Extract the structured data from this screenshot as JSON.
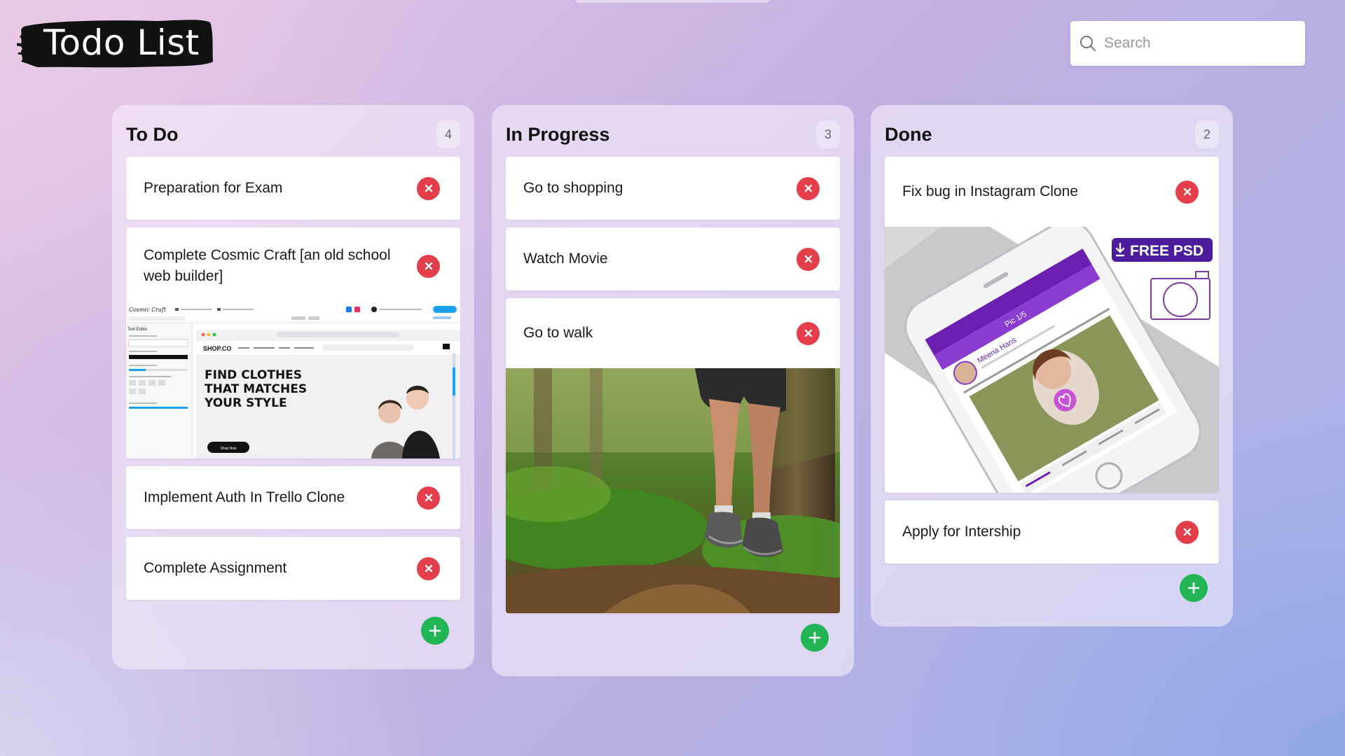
{
  "app": {
    "title": "Todo List"
  },
  "search": {
    "placeholder": "Search",
    "value": ""
  },
  "colors": {
    "delete": "#e53e4b",
    "add": "#22b556"
  },
  "columns": [
    {
      "title": "To Do",
      "count": "4",
      "cards": [
        {
          "text": "Preparation for Exam"
        },
        {
          "text": "Complete Cosmic Craft [an old school web builder]",
          "image": {
            "kind": "website-builder-screenshot",
            "brand": "Cosmic Craft",
            "panel_title": "Text Editor",
            "site_logo": "SHOP.CO",
            "hero_text": [
              "FIND CLOTHES",
              "THAT MATCHES",
              "YOUR STYLE"
            ],
            "cta": "Shop Now"
          }
        },
        {
          "text": "Implement Auth In Trello Clone"
        },
        {
          "text": "Complete Assignment"
        }
      ]
    },
    {
      "title": "In Progress",
      "count": "3",
      "cards": [
        {
          "text": "Go to shopping"
        },
        {
          "text": "Watch Movie"
        },
        {
          "text": "Go to walk",
          "image": {
            "kind": "forest-trail-hiker-photo"
          }
        }
      ]
    },
    {
      "title": "Done",
      "count": "2",
      "cards": [
        {
          "text": "Fix bug in Instagram Clone",
          "image": {
            "kind": "instagram-clone-mockup",
            "badge": "FREE PSD",
            "profile_name": "Meena Hans",
            "pic_counter": "Pic 1/5"
          }
        },
        {
          "text": "Apply for Intership"
        }
      ]
    }
  ]
}
